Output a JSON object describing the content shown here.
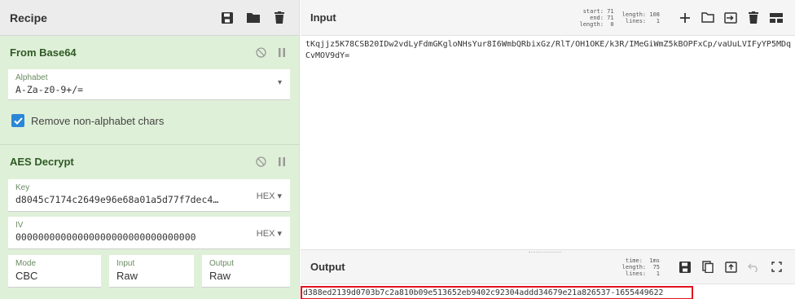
{
  "recipe": {
    "title": "Recipe",
    "icons": [
      "save-icon",
      "folder-icon",
      "trash-icon"
    ]
  },
  "operations": {
    "from_base64": {
      "title": "From Base64",
      "alphabet_label": "Alphabet",
      "alphabet_value": "A-Za-z0-9+/=",
      "remove_non_alpha_label": "Remove non-alphabet chars",
      "remove_non_alpha_checked": true
    },
    "aes_decrypt": {
      "title": "AES Decrypt",
      "key_label": "Key",
      "key_value": "d8045c7174c2649e96e68a01a5d77f7dec4…",
      "key_format": "HEX",
      "iv_label": "IV",
      "iv_value": "00000000000000000000000000000000",
      "iv_format": "HEX",
      "mode_label": "Mode",
      "mode_value": "CBC",
      "input_label": "Input",
      "input_value": "Raw",
      "output_label": "Output",
      "output_value": "Raw"
    }
  },
  "input": {
    "title": "Input",
    "stats_sel": "start: 71\n  end: 71\nlength:  0",
    "stats_len": "length: 108\n lines:   1",
    "text": "tKqjjz5K78CSB20IDw2vdLyFdmGKgloNHsYur8I6WmbQRbixGz/RlT/OH1OKE/k3R/IMeGiWmZ5kBOPFxCp/vaUuLVIFyYP5MDqCvMOV9dY=",
    "icons": [
      "plus-icon",
      "folder-open-icon",
      "import-icon",
      "trash-icon",
      "layout-icon"
    ]
  },
  "output": {
    "title": "Output",
    "stats": "  time:  1ms\nlength:  75\n lines:   1",
    "text": "d388ed2139d0703b7c2a810b09e513652eb9402c92304addd34679e21a826537-1655449622",
    "icons": [
      "save-icon",
      "copy-icon",
      "replace-input-icon",
      "undo-icon",
      "fullscreen-icon"
    ]
  },
  "colors": {
    "recipe_bg": "#dff0d8",
    "checkbox": "#2a87d8",
    "highlight_border": "#e0141e"
  }
}
